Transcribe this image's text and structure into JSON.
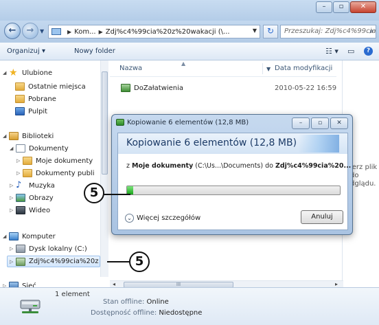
{
  "window": {
    "buttons": {
      "minimize": "–",
      "maximize": "▫",
      "close": "✕"
    }
  },
  "address": {
    "back": "←",
    "forward": "→",
    "segments": [
      "Kom...",
      "Zdj%c4%99cia%20z%20wakacji (\\..."
    ],
    "refresh": "↻",
    "search_placeholder": "Przeszukaj: Zdj%c4%99cia%..."
  },
  "toolbar": {
    "organize": "Organizuj ▾",
    "new_folder": "Nowy folder"
  },
  "sidebar": {
    "items": [
      {
        "label": "Ulubione"
      },
      {
        "label": "Ostatnie miejsca"
      },
      {
        "label": "Pobrane"
      },
      {
        "label": "Pulpit"
      },
      {
        "label": "Biblioteki"
      },
      {
        "label": "Dokumenty"
      },
      {
        "label": "Moje dokumenty"
      },
      {
        "label": "Dokumenty publi"
      },
      {
        "label": "Muzyka"
      },
      {
        "label": "Obrazy"
      },
      {
        "label": "Wideo"
      },
      {
        "label": "Komputer"
      },
      {
        "label": "Dysk lokalny (C:)"
      },
      {
        "label": "Zdj%c4%99cia%20z"
      },
      {
        "label": "Sieć"
      }
    ]
  },
  "content": {
    "columns": {
      "name": "Nazwa",
      "date": "Data modyfikacji"
    },
    "rows": [
      {
        "name": "DoZałatwienia",
        "date": "2010-05-22 16:59"
      }
    ],
    "preview_text": "ierz plik do dglądu."
  },
  "dialog": {
    "title": "Kopiowanie 6 elementów (12,8 MB)",
    "heading": "Kopiowanie 6 elementów (12,8 MB)",
    "line_prefix": "z",
    "line_source": "Moje dokumenty",
    "line_source_path": "(C:\\Us...\\Documents)",
    "line_mid": "do",
    "line_target": "Zdj%c4%99cia%20...",
    "progress": 0.03,
    "more_details": "Więcej szczegółów",
    "cancel": "Anuluj"
  },
  "details": {
    "count": "1 element",
    "offline_status_label": "Stan offline:",
    "offline_status_value": "Online",
    "offline_avail_label": "Dostępność offline:",
    "offline_avail_value": "Niedostępne"
  },
  "callouts": [
    "5",
    "5"
  ]
}
